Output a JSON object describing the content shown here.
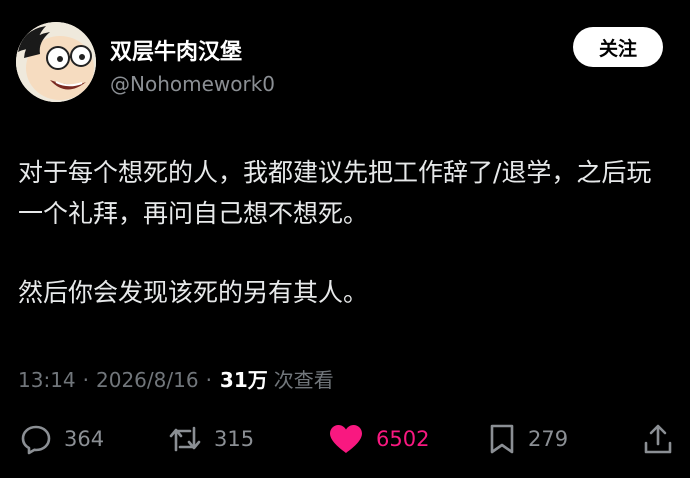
{
  "profile": {
    "display_name": "双层牛肉汉堡",
    "handle": "@Nohomework0",
    "follow_label": "关注",
    "avatar_icon": "cartoon-face-avatar"
  },
  "tweet": {
    "paragraphs": [
      "对于每个想死的人，我都建议先把工作辞了/退学，之后玩一个礼拜，再问自己想不想死。",
      "然后你会发现该死的另有其人。"
    ]
  },
  "meta": {
    "time": "13:14",
    "separator_1": "·",
    "date": "2026/8/16",
    "separator_2": "·",
    "views": "31万",
    "views_label": "次查看"
  },
  "actions": {
    "reply_icon": "reply-icon",
    "reply_count": "364",
    "retweet_icon": "retweet-icon",
    "retweet_count": "315",
    "like_icon": "heart-icon",
    "like_count": "6502",
    "like_color": "#f91880",
    "bookmark_icon": "bookmark-icon",
    "bookmark_count": "279",
    "share_icon": "share-icon"
  }
}
